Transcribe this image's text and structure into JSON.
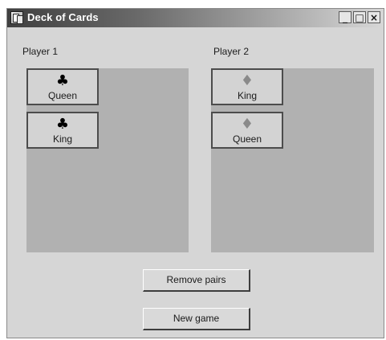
{
  "window": {
    "title": "Deck of Cards",
    "controls": {
      "minimize": "_",
      "maximize": "□",
      "close": "×"
    }
  },
  "player1": {
    "label": "Player 1",
    "cards": [
      {
        "suit_symbol": "♣",
        "suit": "clubs",
        "name": "Queen"
      },
      {
        "suit_symbol": "♣",
        "suit": "clubs",
        "name": "King"
      }
    ]
  },
  "player2": {
    "label": "Player 2",
    "cards": [
      {
        "suit_symbol": "♦",
        "suit": "diamonds",
        "name": "King"
      },
      {
        "suit_symbol": "♦",
        "suit": "diamonds",
        "name": "Queen"
      }
    ]
  },
  "buttons": {
    "remove_pairs": "Remove pairs",
    "new_game": "New game"
  },
  "colors": {
    "form_background": "#d6d6d6",
    "panel_background": "#b1b1b1",
    "club_suit": "#000000",
    "diamond_suit": "#8a8a8a"
  }
}
